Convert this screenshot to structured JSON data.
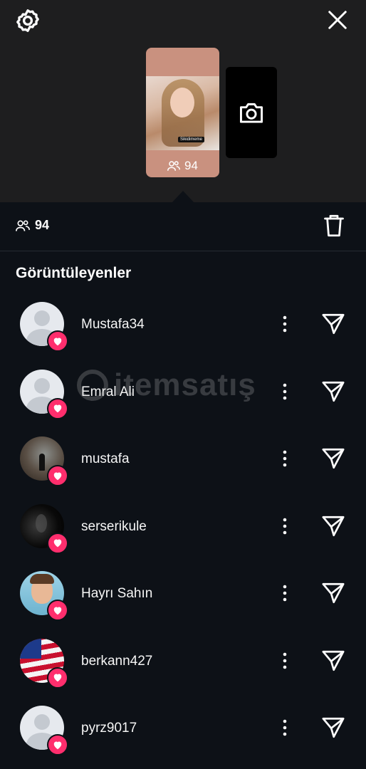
{
  "header": {
    "settings_icon": "gear-icon",
    "close_icon": "close-icon"
  },
  "story": {
    "thumbnail_tag": "Sikidimeme",
    "view_count": "94",
    "camera_icon": "camera-icon"
  },
  "viewer_bar": {
    "count": "94",
    "viewers_icon": "people-icon",
    "delete_icon": "trash-icon"
  },
  "section": {
    "title": "Görüntüleyenler"
  },
  "watermark": {
    "text": "itemsatış"
  },
  "viewers": [
    {
      "username": "Mustafa34",
      "avatar": "default",
      "liked": true
    },
    {
      "username": "Emral Ali",
      "avatar": "default",
      "liked": true
    },
    {
      "username": "mustafa",
      "avatar": "fog",
      "liked": true
    },
    {
      "username": "serserikule",
      "avatar": "dark",
      "liked": true
    },
    {
      "username": "Hayrı Sahın",
      "avatar": "cartoon",
      "liked": true
    },
    {
      "username": "berkann427",
      "avatar": "flag",
      "liked": true
    },
    {
      "username": "pyrz9017",
      "avatar": "default",
      "liked": true
    }
  ],
  "colors": {
    "background": "#0d1117",
    "top_panel": "#1e1e1f",
    "story_card": "#c9917f",
    "heart_badge": "#ff2e6d"
  }
}
